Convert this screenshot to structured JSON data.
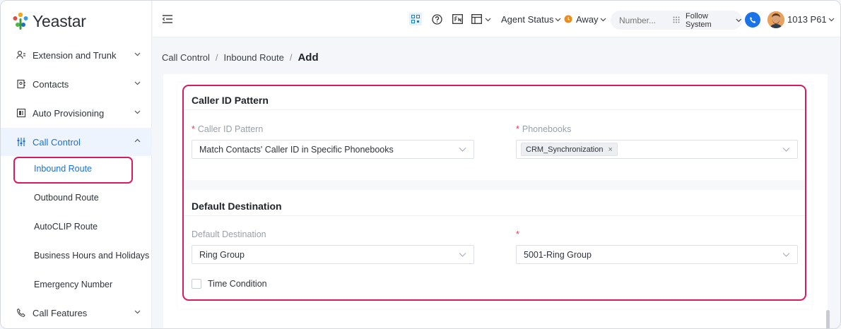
{
  "app": {
    "logo_text": "Yeastar"
  },
  "sidebar": {
    "items": [
      {
        "label": "Extension and Trunk"
      },
      {
        "label": "Contacts"
      },
      {
        "label": "Auto Provisioning"
      },
      {
        "label": "Call Control"
      },
      {
        "label": "Call Features"
      }
    ],
    "sub_items": [
      {
        "label": "Inbound Route"
      },
      {
        "label": "Outbound Route"
      },
      {
        "label": "AutoCLIP Route"
      },
      {
        "label": "Business Hours and Holidays"
      },
      {
        "label": "Emergency Number"
      }
    ]
  },
  "topbar": {
    "agent_status_label": "Agent Status",
    "away_label": "Away",
    "search_placeholder": "Number...",
    "follow_system_label": "Follow System",
    "user_label": "1013 P61"
  },
  "breadcrumb": {
    "items": [
      "Call Control",
      "Inbound Route"
    ],
    "current": "Add"
  },
  "caller_id_section": {
    "title": "Caller ID Pattern",
    "pattern_label": "Caller ID Pattern",
    "pattern_value": "Match Contacts' Caller ID in Specific Phonebooks",
    "phonebooks_label": "Phonebooks",
    "phonebook_tag": "CRM_Synchronization",
    "tag_close": "×"
  },
  "default_destination_section": {
    "title": "Default Destination",
    "destination_label": "Default Destination",
    "destination_value": "Ring Group",
    "target_value": "5001-Ring Group",
    "time_condition_label": "Time Condition"
  },
  "colors": {
    "accent": "#1b6fd8",
    "highlight": "#d81b60",
    "required": "#e53950"
  }
}
